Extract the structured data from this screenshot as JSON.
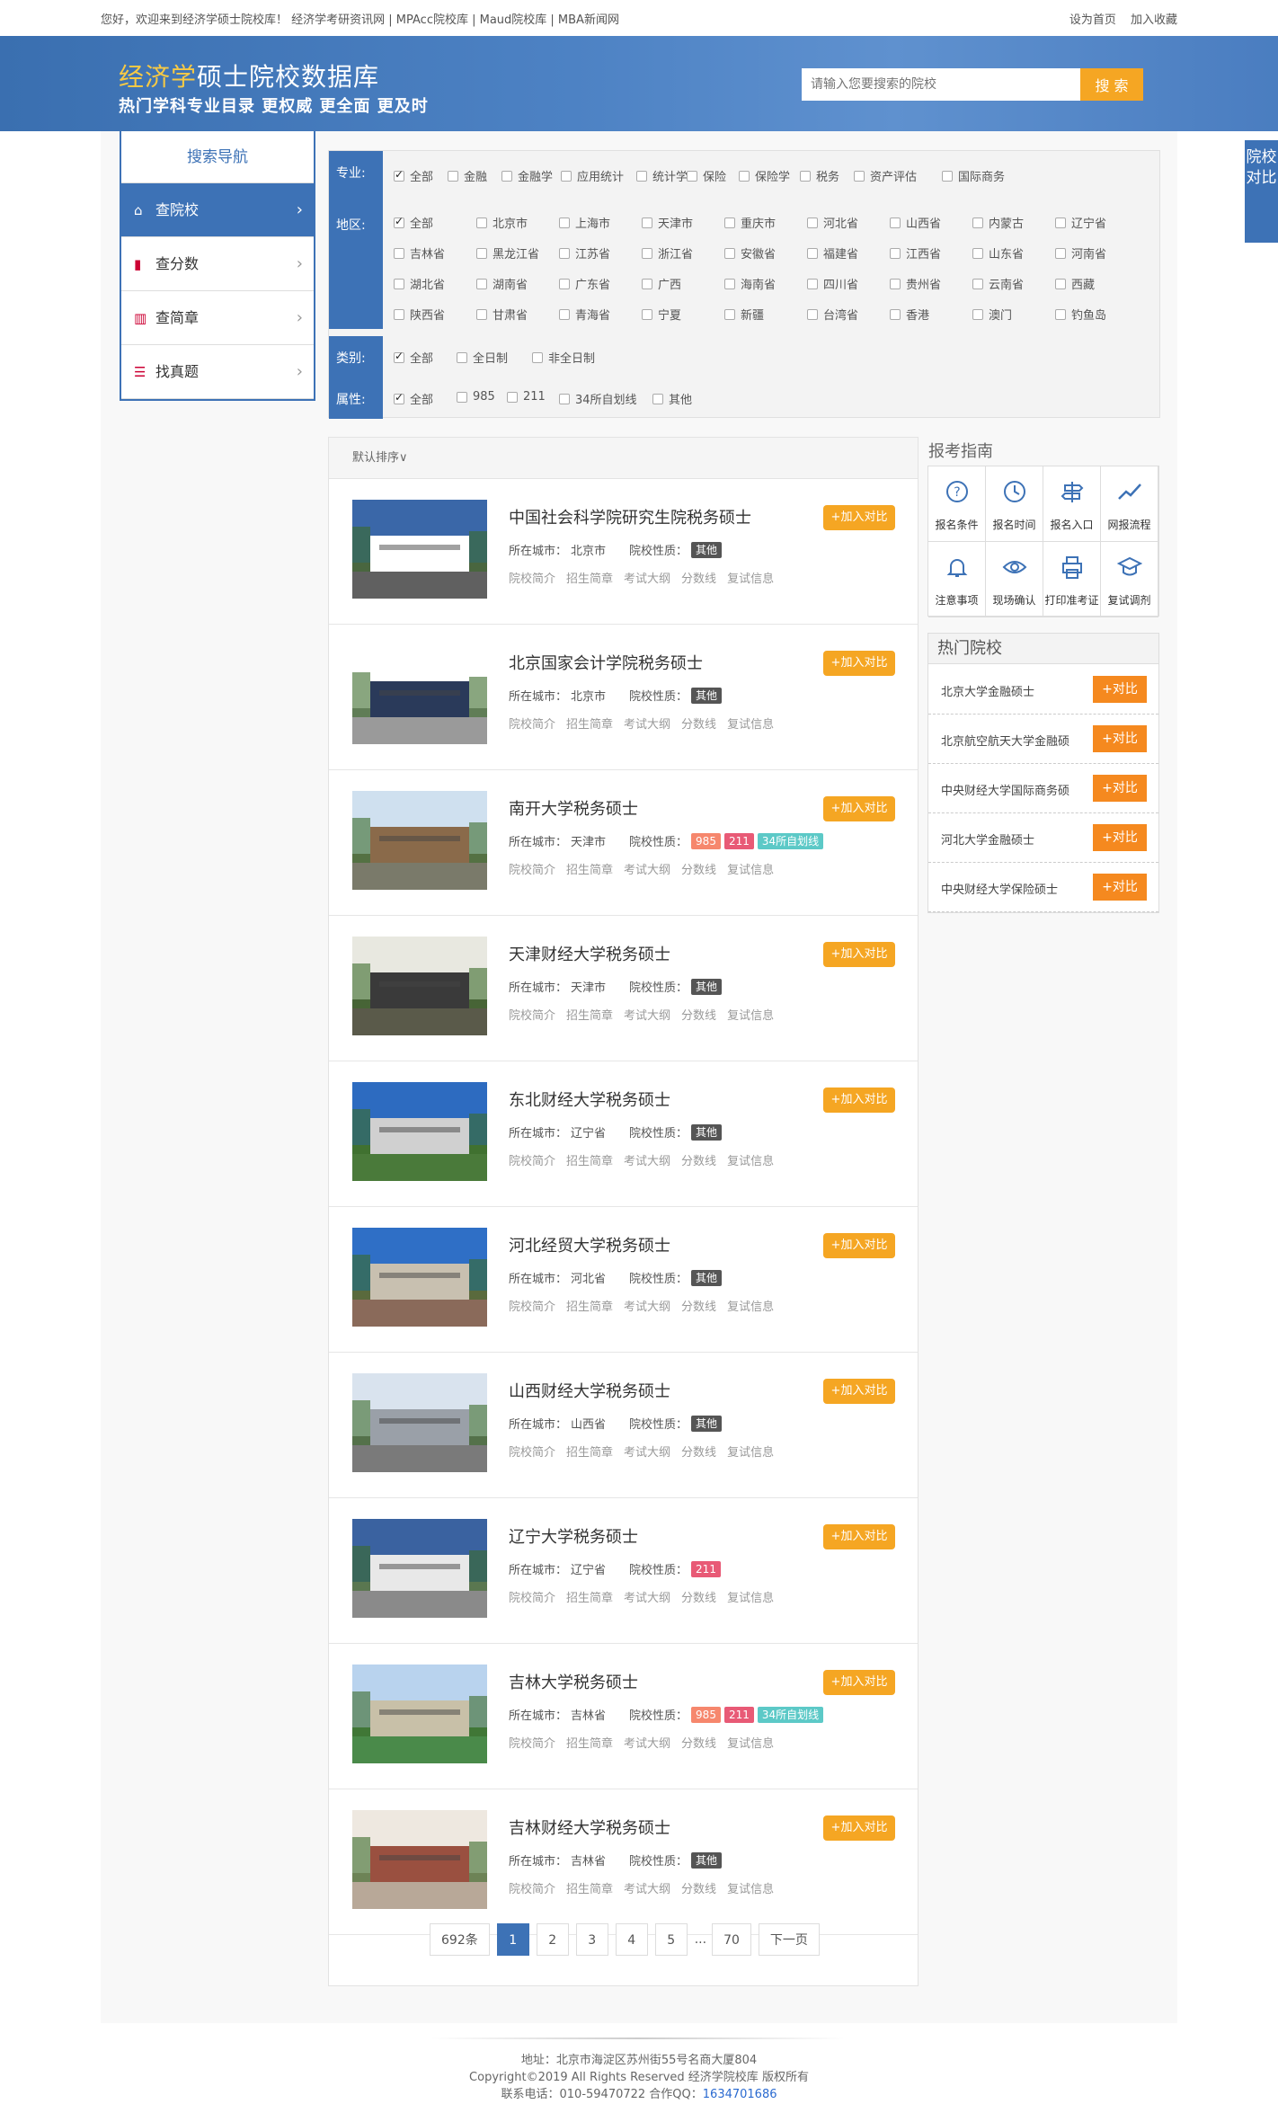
{
  "topbar": {
    "left": "您好，欢迎来到经济学硕士院校库！  经济学考研资讯网 | MPAcc院校库 | Maud院校库 | MBA新闻网",
    "set_home": "设为首页",
    "bookmark": "加入收藏"
  },
  "banner": {
    "title_highlight": "经济学",
    "title_rest": "硕士院校数据库",
    "subtitle": "热门学科专业目录 更权威 更全面 更及时"
  },
  "search": {
    "placeholder": "请输入您要搜索的院校",
    "button": "搜 索"
  },
  "side_tab": {
    "label": "院校对比"
  },
  "nav": {
    "title": "搜索导航",
    "items": [
      {
        "label": "查院校",
        "icon": "home-icon"
      },
      {
        "label": "查分数",
        "icon": "bar-chart-icon"
      },
      {
        "label": "查简章",
        "icon": "book-icon"
      },
      {
        "label": "找真题",
        "icon": "list-icon"
      }
    ]
  },
  "filters": {
    "major_label": "专业:",
    "majors": [
      "全部",
      "金融",
      "金融学",
      "应用统计",
      "统计学",
      "保险",
      "保险学",
      "税务",
      "资产评估",
      "国际商务"
    ],
    "region_label": "地区:",
    "regions": [
      "全部",
      "北京市",
      "上海市",
      "天津市",
      "重庆市",
      "河北省",
      "山西省",
      "内蒙古",
      "辽宁省",
      "吉林省",
      "黑龙江省",
      "江苏省",
      "浙江省",
      "安徽省",
      "福建省",
      "江西省",
      "山东省",
      "河南省",
      "湖北省",
      "湖南省",
      "广东省",
      "广西",
      "海南省",
      "四川省",
      "贵州省",
      "云南省",
      "西藏",
      "陕西省",
      "甘肃省",
      "青海省",
      "宁夏",
      "新疆",
      "台湾省",
      "香港",
      "澳门",
      "钓鱼岛"
    ],
    "type_label": "类别:",
    "types": [
      "全部",
      "全日制",
      "非全日制"
    ],
    "attr_label": "属性:",
    "attrs": [
      "全部",
      "985",
      "211",
      "34所自划线",
      "其他"
    ]
  },
  "list": {
    "sort_label": "默认排序∨",
    "city_label": "所在城市：",
    "nature_label": "院校性质：",
    "add_label": "+加入对比",
    "links": [
      "院校简介",
      "招生简章",
      "考试大纲",
      "分数线",
      "复试信息"
    ],
    "schools": [
      {
        "name": "中国社会科学院研究生院税务硕士",
        "city": "北京市",
        "tags": [
          "其他"
        ]
      },
      {
        "name": "北京国家会计学院税务硕士",
        "city": "北京市",
        "tags": [
          "其他"
        ]
      },
      {
        "name": "南开大学税务硕士",
        "city": "天津市",
        "tags": [
          "985",
          "211",
          "34所自划线"
        ]
      },
      {
        "name": "天津财经大学税务硕士",
        "city": "天津市",
        "tags": [
          "其他"
        ]
      },
      {
        "name": "东北财经大学税务硕士",
        "city": "辽宁省",
        "tags": [
          "其他"
        ]
      },
      {
        "name": "河北经贸大学税务硕士",
        "city": "河北省",
        "tags": [
          "其他"
        ]
      },
      {
        "name": "山西财经大学税务硕士",
        "city": "山西省",
        "tags": [
          "其他"
        ]
      },
      {
        "name": "辽宁大学税务硕士",
        "city": "辽宁省",
        "tags": [
          "211"
        ]
      },
      {
        "name": "吉林大学税务硕士",
        "city": "吉林省",
        "tags": [
          "985",
          "211",
          "34所自划线"
        ]
      },
      {
        "name": "吉林财经大学税务硕士",
        "city": "吉林省",
        "tags": [
          "其他"
        ]
      }
    ]
  },
  "pager": {
    "total": "692条",
    "pages": [
      "1",
      "2",
      "3",
      "4",
      "5"
    ],
    "dots": "...",
    "last": "70",
    "next": "下一页"
  },
  "guide": {
    "title": "报考指南",
    "items": [
      {
        "label": "报名条件",
        "icon": "question-circle-icon"
      },
      {
        "label": "报名时间",
        "icon": "clock-icon"
      },
      {
        "label": "报名入口",
        "icon": "signpost-icon"
      },
      {
        "label": "网报流程",
        "icon": "trend-line-icon"
      },
      {
        "label": "注意事项",
        "icon": "bell-icon"
      },
      {
        "label": "现场确认",
        "icon": "eye-icon"
      },
      {
        "label": "打印准考证",
        "icon": "printer-icon"
      },
      {
        "label": "复试调剂",
        "icon": "graduation-cap-icon"
      }
    ]
  },
  "hot": {
    "title": "热门院校",
    "button": "+对比",
    "items": [
      "北京大学金融硕士",
      "北京航空航天大学金融硕",
      "中央财经大学国际商务硕",
      "河北大学金融硕士",
      "中央财经大学保险硕士"
    ]
  },
  "footer": {
    "address": "地址：北京市海淀区苏州街55号名商大厦804",
    "copyright": "Copyright©2019 All Rights Reserved 经济学院校库 版权所有",
    "phone": "联系电话：010-59470722 合作QQ：",
    "qq": "1634701686"
  },
  "colors": {
    "primary": "#3d72b6",
    "accent": "#f5a623",
    "hot_button": "#f5891f"
  }
}
